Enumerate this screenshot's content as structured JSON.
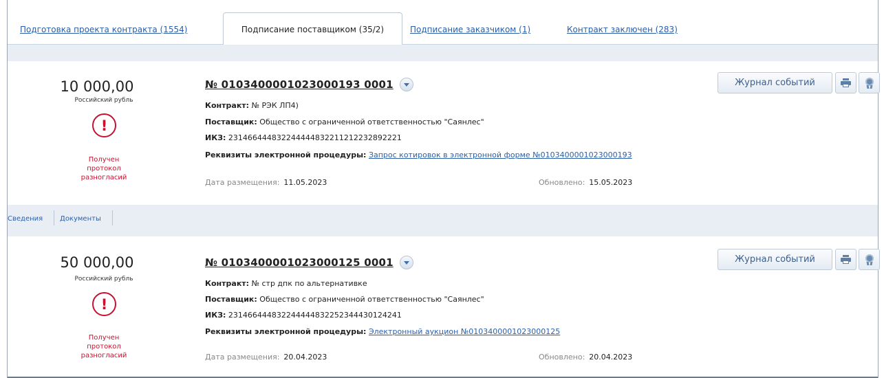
{
  "tabs": [
    {
      "label": "Подготовка проекта контракта (1554)",
      "active": false
    },
    {
      "label": "Подписание поставщиком (35/2)",
      "active": true
    },
    {
      "label": "Подписание заказчиком (1)",
      "active": false
    },
    {
      "label": "Контракт заключен (283)",
      "active": false
    }
  ],
  "records": [
    {
      "amount": "10 000,00",
      "currency": "Российский рубль",
      "status_icon": "exclamation-circle-icon",
      "status_lines": [
        "Получен",
        "протокол",
        "разногласий"
      ],
      "number": "№ 0103400001023000193 0001",
      "contract_label": "Контракт:",
      "contract_value": "№ РЭК ЛП4)",
      "supplier_label": "Поставщик:",
      "supplier_value": "Общество с ограниченной ответственностью \"Саянлес\"",
      "ikz_label": "ИКЗ:",
      "ikz_value": "231466444832244444832211212232892221",
      "procedure_label": "Реквизиты электронной процедуры:",
      "procedure_link": "Запрос котировок в электронной форме №0103400001023000193",
      "posted_label": "Дата размещения:",
      "posted_value": "11.05.2023",
      "updated_label": "Обновлено:",
      "updated_value": "15.05.2023",
      "journal_label": "Журнал событий"
    },
    {
      "amount": "50 000,00",
      "currency": "Российский рубль",
      "status_icon": "exclamation-circle-icon",
      "status_lines": [
        "Получен",
        "протокол",
        "разногласий"
      ],
      "number": "№ 0103400001023000125 0001",
      "contract_label": "Контракт:",
      "contract_value": "№ стр дпк по альтернативке",
      "supplier_label": "Поставщик:",
      "supplier_value": "Общество с ограниченной ответственностью \"Саянлес\"",
      "ikz_label": "ИКЗ:",
      "ikz_value": "231466444832244444832252344430124241",
      "procedure_label": "Реквизиты электронной процедуры:",
      "procedure_link": "Электронный аукцион №0103400001023000125",
      "posted_label": "Дата размещения:",
      "posted_value": "20.04.2023",
      "updated_label": "Обновлено:",
      "updated_value": "20.04.2023",
      "journal_label": "Журнал событий"
    }
  ],
  "subtabs": {
    "info": "Сведения",
    "documents": "Документы"
  },
  "colors": {
    "link": "#2a5fa8",
    "warning": "#c8102e",
    "band": "#e9eef4"
  }
}
